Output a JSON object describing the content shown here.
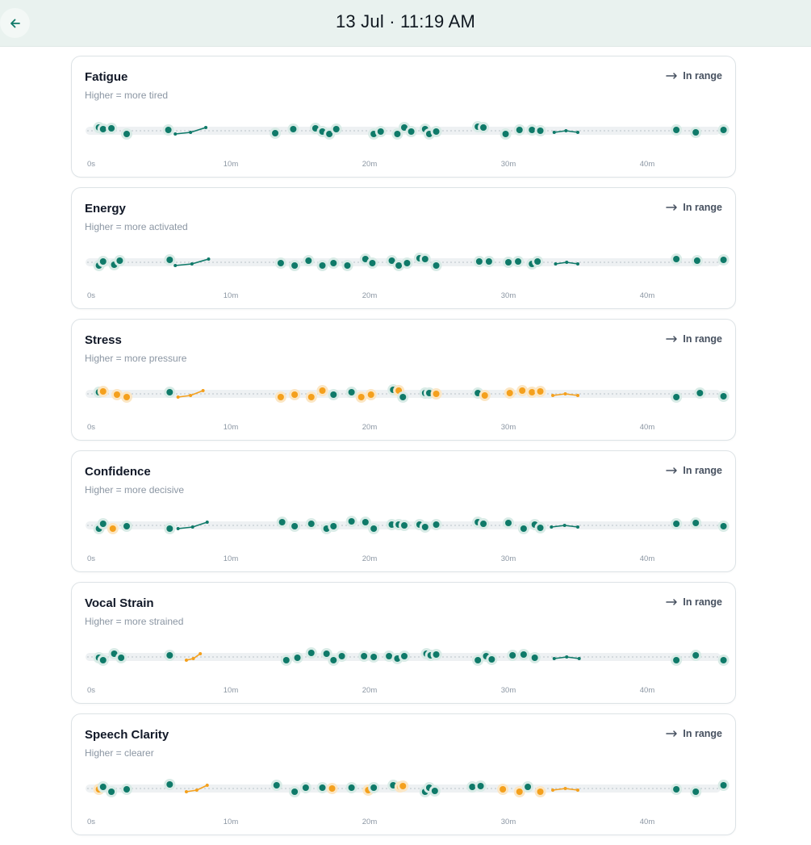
{
  "header": {
    "title": "13 Jul · 11:19 AM"
  },
  "colors": {
    "teal": "#0f7a69",
    "amber": "#f4a01d",
    "halo": "#d8ebe6",
    "track": "#eef1f3"
  },
  "metrics": [
    {
      "title": "Fatigue",
      "subtitle": "Higher = more tired",
      "status": "In range"
    },
    {
      "title": "Energy",
      "subtitle": "Higher = more activated",
      "status": "In range"
    },
    {
      "title": "Stress",
      "subtitle": "Higher = more pressure",
      "status": "In range"
    },
    {
      "title": "Confidence",
      "subtitle": "Higher = more decisive",
      "status": "In range"
    },
    {
      "title": "Vocal Strain",
      "subtitle": "Higher = more strained",
      "status": "In range"
    },
    {
      "title": "Speech Clarity",
      "subtitle": "Higher = clearer",
      "status": "In range"
    }
  ],
  "chart_data": [
    {
      "type": "scatter",
      "title": "Fatigue",
      "x_ticks": [
        "0s",
        "10m",
        "20m",
        "30m",
        "40m"
      ],
      "points_minutes": [
        0.5,
        0.8,
        1.4,
        2.5,
        5.5,
        13.2,
        14.5,
        16.1,
        16.6,
        17.1,
        17.6,
        20.3,
        20.8,
        22.0,
        22.5,
        23.0,
        24.0,
        24.3,
        24.8,
        27.8,
        28.2,
        29.8,
        30.8,
        31.7,
        32.3,
        42.1,
        43.5,
        45.5
      ],
      "points_color": [
        "t",
        "t",
        "t",
        "t",
        "t",
        "t",
        "t",
        "t",
        "t",
        "t",
        "t",
        "t",
        "t",
        "t",
        "t",
        "t",
        "t",
        "t",
        "t",
        "t",
        "t",
        "t",
        "t",
        "t",
        "t",
        "t",
        "t",
        "t"
      ],
      "trend": [
        [
          6.0,
          8.2
        ],
        [
          33.3,
          35.0
        ]
      ]
    },
    {
      "type": "scatter",
      "title": "Energy",
      "x_ticks": [
        "0s",
        "10m",
        "20m",
        "30m",
        "40m"
      ],
      "points_minutes": [
        0.5,
        0.8,
        1.6,
        2.0,
        5.6,
        13.6,
        14.6,
        15.6,
        16.6,
        17.4,
        18.4,
        19.7,
        20.2,
        21.6,
        22.1,
        22.7,
        23.6,
        24.0,
        24.8,
        27.9,
        28.6,
        30.0,
        30.7,
        31.7,
        32.1,
        42.1,
        43.6,
        45.5
      ],
      "points_color": [
        "t",
        "t",
        "t",
        "t",
        "t",
        "t",
        "t",
        "t",
        "t",
        "t",
        "t",
        "t",
        "t",
        "t",
        "t",
        "t",
        "t",
        "t",
        "t",
        "t",
        "t",
        "t",
        "t",
        "t",
        "t",
        "t",
        "t",
        "t"
      ],
      "trend": [
        [
          6.0,
          8.4
        ],
        [
          33.4,
          35.0
        ]
      ]
    },
    {
      "type": "scatter",
      "title": "Stress",
      "x_ticks": [
        "0s",
        "10m",
        "20m",
        "30m",
        "40m"
      ],
      "points_minutes": [
        0.5,
        0.8,
        1.8,
        2.5,
        5.6,
        13.6,
        14.6,
        15.8,
        16.6,
        17.4,
        18.7,
        19.4,
        20.1,
        21.7,
        22.1,
        22.4,
        24.0,
        24.3,
        24.8,
        27.8,
        28.3,
        30.1,
        31.0,
        31.7,
        32.3,
        42.1,
        43.8,
        45.5
      ],
      "points_color": [
        "t",
        "a",
        "a",
        "a",
        "t",
        "a",
        "a",
        "a",
        "a",
        "t",
        "t",
        "a",
        "a",
        "t",
        "a",
        "t",
        "t",
        "t",
        "a",
        "t",
        "a",
        "a",
        "a",
        "a",
        "a",
        "t",
        "t",
        "t"
      ],
      "trend": [
        [
          6.2,
          8.0
        ],
        [
          33.2,
          35.0
        ]
      ]
    },
    {
      "type": "scatter",
      "title": "Confidence",
      "x_ticks": [
        "0s",
        "10m",
        "20m",
        "30m",
        "40m"
      ],
      "points_minutes": [
        0.5,
        0.8,
        1.5,
        2.5,
        5.6,
        13.7,
        14.6,
        15.8,
        16.9,
        17.4,
        18.7,
        19.7,
        20.3,
        21.6,
        22.1,
        22.5,
        23.6,
        24.0,
        24.8,
        27.8,
        28.2,
        30.0,
        31.1,
        31.9,
        32.3,
        42.1,
        43.5,
        45.5
      ],
      "points_color": [
        "t",
        "t",
        "a",
        "t",
        "t",
        "t",
        "t",
        "t",
        "t",
        "t",
        "t",
        "t",
        "t",
        "t",
        "t",
        "t",
        "t",
        "t",
        "t",
        "t",
        "t",
        "t",
        "t",
        "t",
        "t",
        "t",
        "t",
        "t"
      ],
      "trend": [
        [
          6.2,
          8.3
        ],
        [
          33.1,
          35.0
        ]
      ]
    },
    {
      "type": "scatter",
      "title": "Vocal Strain",
      "x_ticks": [
        "0s",
        "10m",
        "20m",
        "30m",
        "40m"
      ],
      "points_minutes": [
        0.5,
        0.8,
        1.6,
        2.1,
        5.6,
        14.0,
        14.8,
        15.8,
        16.9,
        17.4,
        18.0,
        19.6,
        20.3,
        21.4,
        22.0,
        22.5,
        24.1,
        24.4,
        24.8,
        27.8,
        28.4,
        28.8,
        30.3,
        31.1,
        31.9,
        42.1,
        43.5,
        45.5
      ],
      "points_color": [
        "t",
        "t",
        "t",
        "t",
        "t",
        "t",
        "t",
        "t",
        "t",
        "t",
        "t",
        "t",
        "t",
        "t",
        "t",
        "t",
        "t",
        "t",
        "t",
        "t",
        "t",
        "t",
        "t",
        "t",
        "t",
        "t",
        "t",
        "t"
      ],
      "trend": [
        [
          6.8,
          7.8
        ],
        [
          33.3,
          35.1
        ]
      ]
    },
    {
      "type": "scatter",
      "title": "Speech Clarity",
      "x_ticks": [
        "0s",
        "10m",
        "20m",
        "30m",
        "40m"
      ],
      "points_minutes": [
        0.5,
        0.8,
        1.4,
        2.5,
        5.6,
        13.3,
        14.6,
        15.4,
        16.6,
        17.3,
        18.7,
        19.9,
        20.3,
        21.7,
        22.2,
        22.4,
        24.0,
        24.3,
        24.7,
        27.4,
        28.0,
        29.6,
        30.8,
        31.4,
        32.3,
        42.1,
        43.5,
        45.5
      ],
      "points_color": [
        "a",
        "t",
        "t",
        "t",
        "t",
        "t",
        "t",
        "t",
        "t",
        "a",
        "t",
        "a",
        "t",
        "t",
        "a",
        "a",
        "t",
        "t",
        "t",
        "t",
        "t",
        "a",
        "a",
        "t",
        "a",
        "t",
        "t",
        "t"
      ],
      "trend": [
        [
          6.8,
          8.3
        ],
        [
          33.2,
          35.0
        ]
      ]
    }
  ]
}
